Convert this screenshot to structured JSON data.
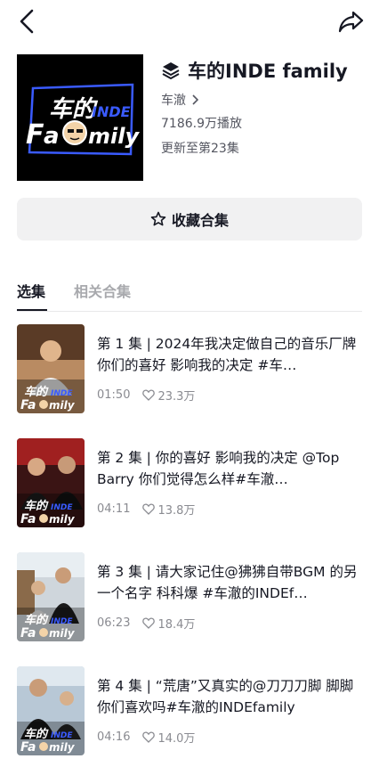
{
  "header": {
    "back_icon": "chevron-left-icon",
    "share_icon": "share-arrow-icon"
  },
  "collection": {
    "cover_logo_line1": "车的",
    "cover_logo_line1b": "INDE",
    "cover_logo_line2a": "F",
    "cover_logo_line2b": "a",
    "cover_logo_line2c": "mily",
    "title": "车的INDE family",
    "author": "车澈",
    "plays": "7186.9万播放",
    "updated": "更新至第23集"
  },
  "collect_button": {
    "label": "收藏合集",
    "icon": "star-outline-icon"
  },
  "tabs": [
    {
      "label": "选集",
      "active": true
    },
    {
      "label": "相关合集",
      "active": false
    }
  ],
  "episodes": [
    {
      "text": "第 1 集 | 2024年我决定做自己的音乐厂牌 你们的喜好 影响我的决定 #车…",
      "duration": "01:50",
      "likes": "23.3万"
    },
    {
      "text": "第 2 集 | 你的喜好 影响我的决定 @Top Barry 你们觉得怎么样#车澈…",
      "duration": "04:11",
      "likes": "13.8万"
    },
    {
      "text": "第 3 集 | 请大家记住@狒狒自带BGM 的另一个名字 科科爆 #车澈的INDEf…",
      "duration": "06:23",
      "likes": "18.4万"
    },
    {
      "text": "第 4 集 | “荒唐”又真实的@刀刀刀脚 脚脚 你们喜欢吗#车澈的INDEfamily",
      "duration": "04:16",
      "likes": "14.0万"
    }
  ],
  "colors": {
    "accent_blue": "#3a5bff",
    "text_primary": "#161823",
    "text_secondary": "#545660",
    "button_bg": "#f1f1f2"
  }
}
